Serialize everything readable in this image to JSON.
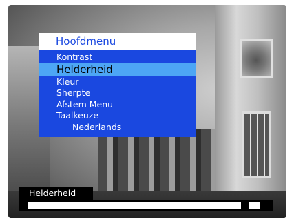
{
  "menu": {
    "title": "Hoofdmenu",
    "items": [
      {
        "label": "Kontrast",
        "selected": false
      },
      {
        "label": "Helderheid",
        "selected": true
      },
      {
        "label": "Kleur",
        "selected": false
      },
      {
        "label": "Sherpte",
        "selected": false
      },
      {
        "label": "Afstem Menu",
        "selected": false
      },
      {
        "label": "Taalkeuze",
        "selected": false
      }
    ],
    "sub_item": "Nederlands"
  },
  "osd": {
    "label": "Helderheid",
    "level": 0.91
  },
  "colors": {
    "menu_bg": "#1a48e0",
    "menu_selected": "#4da6f5",
    "title_bg": "#ffffff",
    "osd_bg": "#000000"
  }
}
